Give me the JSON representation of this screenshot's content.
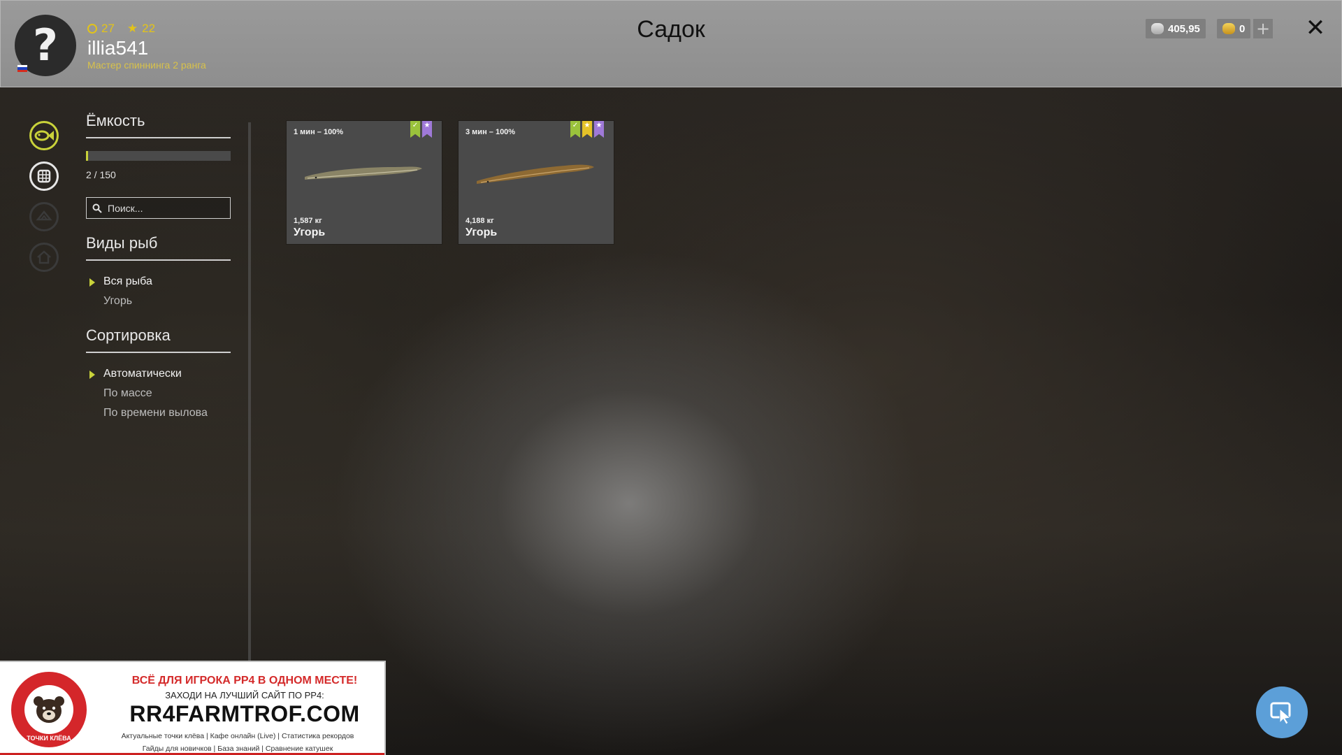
{
  "header": {
    "title": "Садок",
    "avatar_glyph": "?",
    "flag": "russia-flag",
    "level": "27",
    "stars": "22",
    "username": "illia541",
    "rank": "Мастер спиннинга 2 ранга",
    "silver": "405,95",
    "gold": "0",
    "plus_label": "+",
    "close_label": "✕"
  },
  "rail": [
    "fish-icon",
    "keepnet-icon",
    "boat-icon",
    "home-icon"
  ],
  "panel": {
    "capacity_title": "Ёмкость",
    "capacity_text": "2 / 150",
    "capacity_used": 2,
    "capacity_max": 150,
    "search_placeholder": "Поиск...",
    "species_title": "Виды рыб",
    "species": [
      {
        "label": "Вся рыба",
        "active": true
      },
      {
        "label": "Угорь",
        "active": false
      }
    ],
    "sort_title": "Сортировка",
    "sort": [
      {
        "label": "Автоматически",
        "active": true
      },
      {
        "label": "По массе",
        "active": false
      },
      {
        "label": "По времени вылова",
        "active": false
      }
    ]
  },
  "fish": [
    {
      "time": "1 мин – 100%",
      "weight": "1,587 кг",
      "name": "Угорь",
      "badges": [
        "green",
        "purple"
      ]
    },
    {
      "time": "3 мин – 100%",
      "weight": "4,188 кг",
      "name": "Угорь",
      "badges": [
        "green",
        "yellow",
        "purple"
      ]
    }
  ],
  "ad": {
    "headline": "ВСЁ ДЛЯ ИГРОКА РР4 В ОДНОМ МЕСТЕ!",
    "sub": "ЗАХОДИ НА ЛУЧШИЙ САЙТ ПО РР4:",
    "site": "RR4FARMTROF.COM",
    "links_1": "Актуальные точки клёва  |  Кафе онлайн (Live)  |  Статистика рекордов",
    "links_2": "Гайды для новичков  |  База знаний  |  Сравнение катушек",
    "logo_text": "ТОЧКИ КЛЁВА"
  },
  "colors": {
    "accent": "#c9d23a",
    "header_bg": "#969696",
    "card_bg": "#4a4a4a",
    "cursor_btn": "#5c9fd8"
  }
}
